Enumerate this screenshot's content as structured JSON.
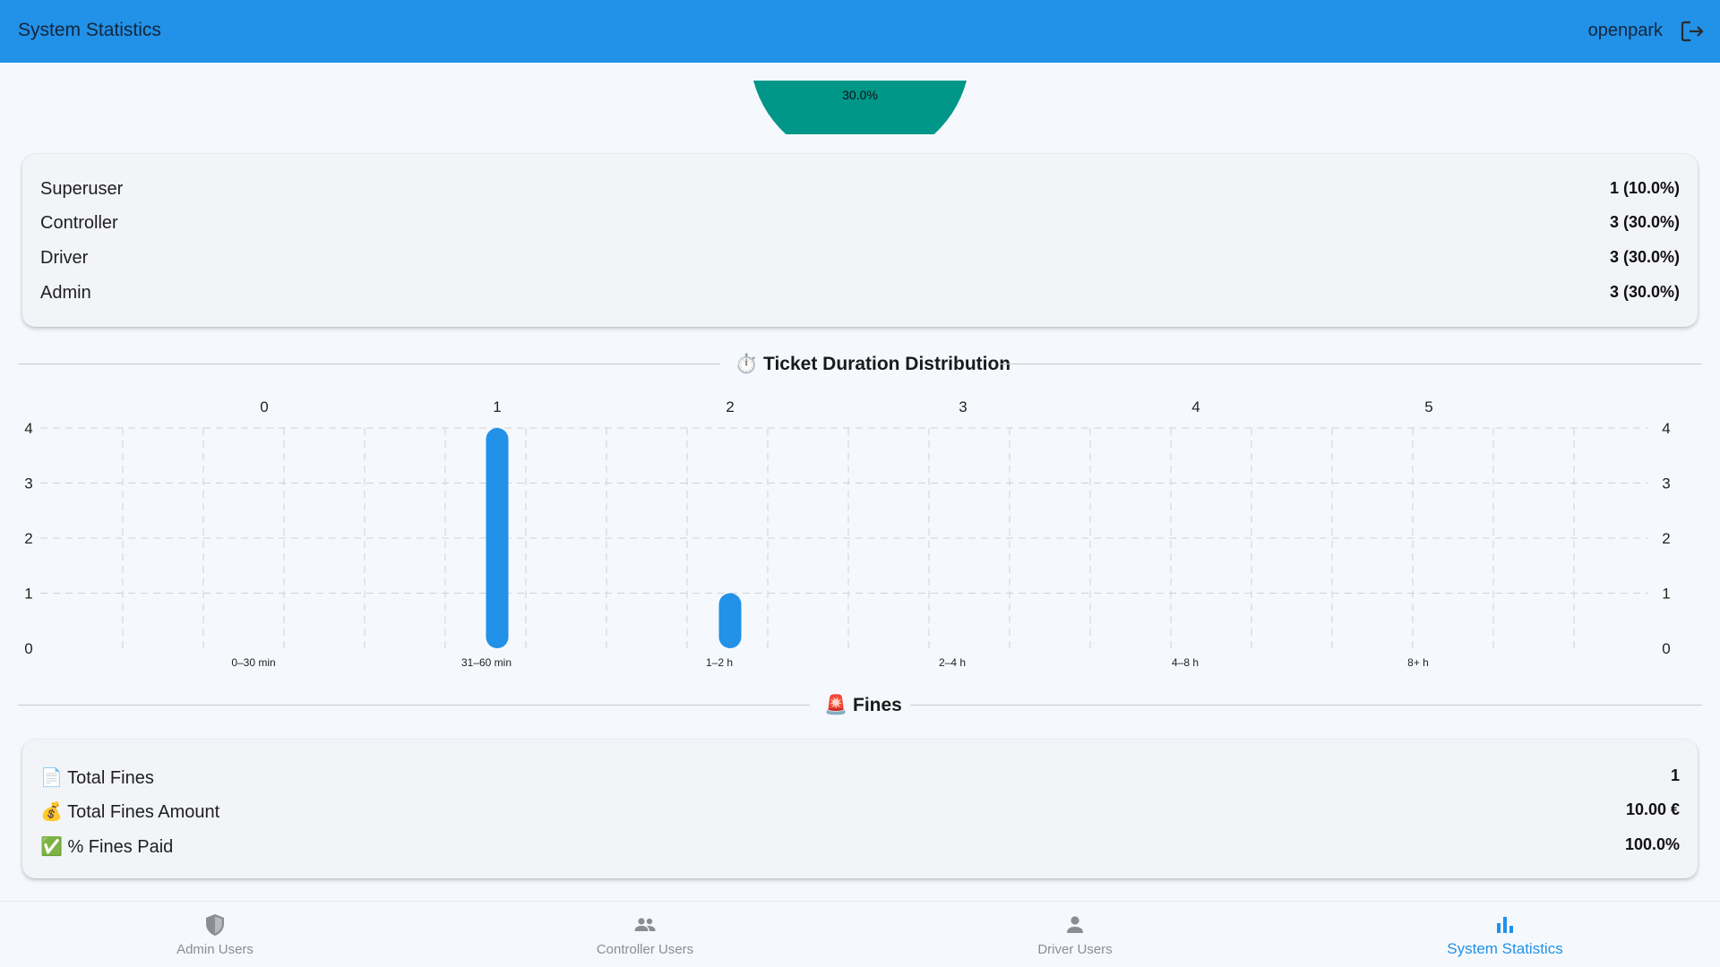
{
  "appbar": {
    "title": "System Statistics",
    "username": "openpark"
  },
  "pie": {
    "visible_slice_label": "30.0%",
    "slice_color": "#009688"
  },
  "role_stats": [
    {
      "label": "Superuser",
      "value": "1 (10.0%)"
    },
    {
      "label": "Controller",
      "value": "3 (30.0%)"
    },
    {
      "label": "Driver",
      "value": "3 (30.0%)"
    },
    {
      "label": "Admin",
      "value": "3 (30.0%)"
    }
  ],
  "duration_section": {
    "icon": "⏱️",
    "title": "Ticket Duration Distribution"
  },
  "chart_data": {
    "type": "bar",
    "categories": [
      "0–30 min",
      "31–60 min",
      "1–2 h",
      "2–4 h",
      "4–8 h",
      "8+ h"
    ],
    "values": [
      0,
      4,
      1,
      0,
      0,
      0
    ],
    "top_axis_ticks": [
      "0",
      "1",
      "2",
      "3",
      "4",
      "5"
    ],
    "yticks": [
      "0",
      "1",
      "2",
      "3",
      "4"
    ],
    "ylim": [
      0,
      4
    ],
    "grid": true,
    "bar_color": "#2291e8"
  },
  "fines_section": {
    "icon": "🚨",
    "title": "Fines"
  },
  "fines_stats": [
    {
      "icon": "📄",
      "label": "Total Fines",
      "value": "1"
    },
    {
      "icon": "💰",
      "label": "Total Fines Amount",
      "value": "10.00 €"
    },
    {
      "icon": "✅",
      "label": "% Fines Paid",
      "value": "100.0%"
    }
  ],
  "bottom_nav": [
    {
      "label": "Admin Users",
      "icon": "shield-icon"
    },
    {
      "label": "Controller Users",
      "icon": "people-icon"
    },
    {
      "label": "Driver Users",
      "icon": "person-icon"
    },
    {
      "label": "System Statistics",
      "icon": "bar-chart-icon"
    }
  ],
  "colors": {
    "primary": "#2291e8",
    "inactive": "#8a8d91"
  }
}
